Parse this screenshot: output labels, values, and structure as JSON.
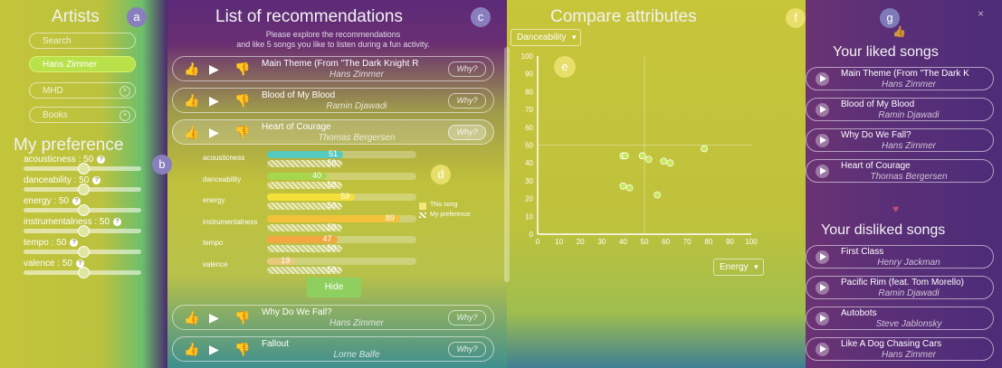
{
  "artists": {
    "title": "Artists",
    "badge": "a",
    "search_placeholder": "Search",
    "items": [
      {
        "label": "Hans Zimmer",
        "selected": true
      },
      {
        "label": "MHD",
        "selected": false
      },
      {
        "label": "Books",
        "selected": false
      }
    ]
  },
  "preference": {
    "title": "My preference",
    "badge": "b",
    "sliders": [
      {
        "label": "acousticness : 50",
        "value": 50
      },
      {
        "label": "danceability : 50",
        "value": 50
      },
      {
        "label": "energy : 50",
        "value": 50
      },
      {
        "label": "instrumentalness : 50",
        "value": 50
      },
      {
        "label": "tempo : 50",
        "value": 50
      },
      {
        "label": "valence : 50",
        "value": 50
      }
    ]
  },
  "recommendations": {
    "title": "List of recommendations",
    "badge": "c",
    "intro_line1": "Please explore the recommendations",
    "intro_line2": "and like 5 songs you like to listen during a fun activity.",
    "why_label": "Why?",
    "hide_label": "Hide",
    "songs": [
      {
        "song": "Main Theme (From \"The Dark Knight R",
        "artist": "Hans Zimmer",
        "active": false
      },
      {
        "song": "Blood of My Blood",
        "artist": "Ramin Djawadi",
        "active": false
      },
      {
        "song": "Heart of Courage",
        "artist": "Thomas Bergersen",
        "active": true
      },
      {
        "song": "Why Do We Fall?",
        "artist": "Hans Zimmer",
        "active": false
      },
      {
        "song": "Fallout",
        "artist": "Lorne Balfe",
        "active": false
      }
    ],
    "detail": {
      "badge": "d",
      "legend_song": "This song",
      "legend_pref": "My preference",
      "attributes": [
        {
          "label": "acousticness",
          "song": 51,
          "pref": 50
        },
        {
          "label": "danceability",
          "song": 40,
          "pref": 50
        },
        {
          "label": "energy",
          "song": 59,
          "pref": 50
        },
        {
          "label": "instrumentalness",
          "song": 89,
          "pref": 50
        },
        {
          "label": "tempo",
          "song": 47,
          "pref": 50
        },
        {
          "label": "valence",
          "song": 19,
          "pref": 50
        }
      ]
    }
  },
  "compare": {
    "title": "Compare attributes",
    "badge": "f",
    "chart_badge": "e",
    "y_attribute": "Danceability",
    "x_attribute": "Energy"
  },
  "chart_data": {
    "type": "scatter",
    "xlabel": "Energy",
    "ylabel": "Danceability",
    "xlim": [
      0,
      100
    ],
    "ylim": [
      0,
      100
    ],
    "xticks": [
      0,
      10,
      20,
      30,
      40,
      50,
      60,
      70,
      80,
      90,
      100
    ],
    "yticks": [
      0,
      10,
      20,
      30,
      40,
      50,
      60,
      70,
      80,
      90,
      100
    ],
    "points": [
      {
        "x": 40,
        "y": 44
      },
      {
        "x": 41,
        "y": 44
      },
      {
        "x": 49,
        "y": 44
      },
      {
        "x": 52,
        "y": 42
      },
      {
        "x": 59,
        "y": 41
      },
      {
        "x": 62,
        "y": 40
      },
      {
        "x": 78,
        "y": 48
      },
      {
        "x": 40,
        "y": 27
      },
      {
        "x": 43,
        "y": 26
      },
      {
        "x": 56,
        "y": 22
      }
    ]
  },
  "playlists": {
    "badge": "g",
    "close": "×",
    "liked_title": "Your liked songs",
    "disliked_title": "Your disliked songs",
    "liked": [
      {
        "song": "Main Theme (From \"The Dark K",
        "artist": "Hans Zimmer"
      },
      {
        "song": "Blood of My Blood",
        "artist": "Ramin Djawadi"
      },
      {
        "song": "Why Do We Fall?",
        "artist": "Hans Zimmer"
      },
      {
        "song": "Heart of Courage",
        "artist": "Thomas Bergersen"
      }
    ],
    "disliked": [
      {
        "song": "First Class",
        "artist": "Henry Jackman"
      },
      {
        "song": "Pacific Rim (feat. Tom Morello)",
        "artist": "Ramin Djawadi"
      },
      {
        "song": "Autobots",
        "artist": "Steve Jablonsky"
      },
      {
        "song": "Like A Dog Chasing Cars",
        "artist": "Hans Zimmer"
      }
    ]
  }
}
